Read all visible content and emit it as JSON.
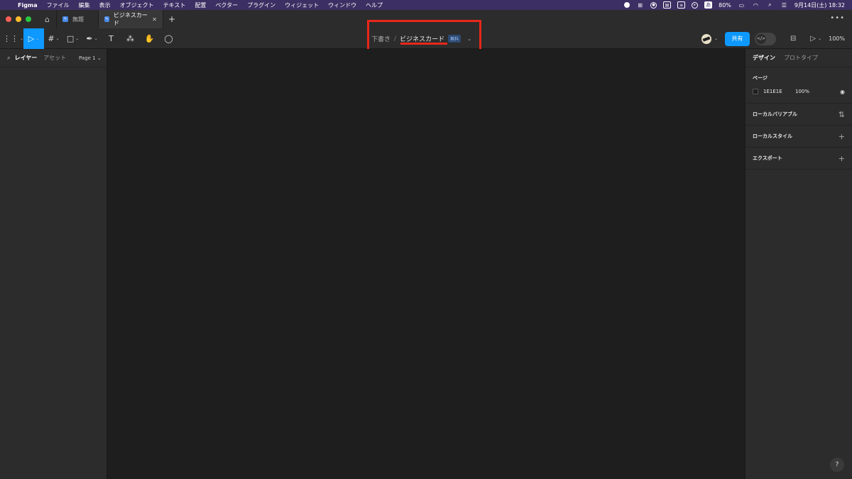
{
  "menubar": {
    "app": "Figma",
    "items": [
      "ファイル",
      "編集",
      "表示",
      "オブジェクト",
      "テキスト",
      "配置",
      "ベクター",
      "プラグイン",
      "ウィジェット",
      "ウィンドウ",
      "ヘルプ"
    ],
    "battery": "80%",
    "input_method": "あ",
    "datetime": "9月14日(土) 18:32"
  },
  "tabs": [
    {
      "label": "無題"
    },
    {
      "label": "ビジネスカード"
    }
  ],
  "breadcrumb": {
    "location": "下書き",
    "separator": "/",
    "file_name": "ビジネスカード",
    "plan_badge": "無料"
  },
  "toolbar": {
    "share_label": "共有",
    "zoom": "100%"
  },
  "left_panel": {
    "layers_tab": "レイヤー",
    "assets_tab": "アセット",
    "page_selector": "Page 1"
  },
  "right_panel": {
    "design_tab": "デザイン",
    "prototype_tab": "プロトタイプ",
    "page_section": {
      "title": "ページ",
      "bg_hex": "1E1E1E",
      "opacity": "100%"
    },
    "sections": [
      "ローカルバリアブル",
      "ローカルスタイル",
      "エクスポート"
    ]
  },
  "colors": {
    "accent": "#0d99ff",
    "highlight": "#e8281a",
    "canvas": "#1e1e1e"
  },
  "help_label": "?"
}
